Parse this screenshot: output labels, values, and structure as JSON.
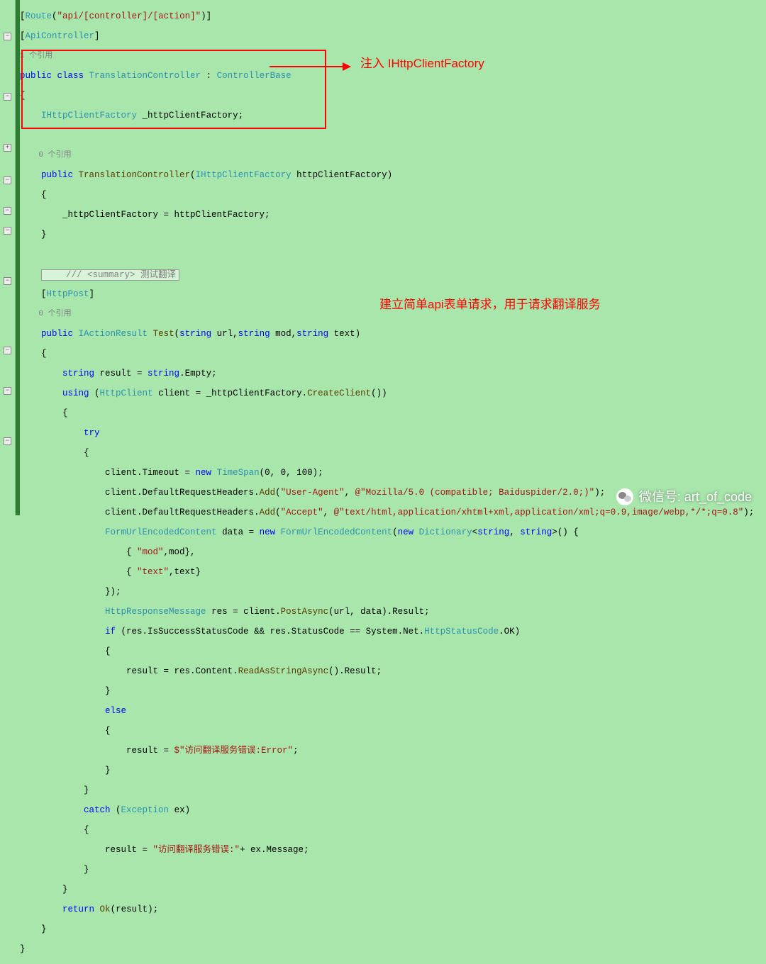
{
  "annotations": {
    "a1": "注入 IHttpClientFactory",
    "a2": "建立简单api表单请求，用于请求翻译服务"
  },
  "watermark": "微信号: art_of_code",
  "lines": {
    "l1a": "[",
    "l1b": "Route",
    "l1c": "(",
    "l1d": "\"api/[controller]/[action]\"",
    "l1e": ")]",
    "l2a": "[",
    "l2b": "ApiController",
    "l2c": "]",
    "l3": "1 个引用",
    "l4a": "public class ",
    "l4b": "TranslationController",
    "l4c": " : ",
    "l4d": "ControllerBase",
    "l5": "{",
    "l6a": "    ",
    "l6b": "IHttpClientFactory",
    "l6c": " _httpClientFactory;",
    "l7": "",
    "l8": "    0 个引用",
    "l9a": "    public ",
    "l9b": "TranslationController",
    "l9c": "(",
    "l9d": "IHttpClientFactory",
    "l9e": " httpClientFactory)",
    "l10": "    {",
    "l11": "        _httpClientFactory = httpClientFactory;",
    "l12": "    }",
    "l13": "",
    "l14": "    /// <summary> 测试翻译",
    "l15a": "    [",
    "l15b": "HttpPost",
    "l15c": "]",
    "l16": "    0 个引用",
    "l17a": "    public ",
    "l17b": "IActionResult",
    "l17c": " ",
    "l17d": "Test",
    "l17e": "(",
    "l17f": "string",
    "l17g": " url,",
    "l17h": "string",
    "l17i": " mod,",
    "l17j": "string",
    "l17k": " text)",
    "l18": "    {",
    "l19a": "        string",
    "l19b": " result = ",
    "l19c": "string",
    "l19d": ".Empty;",
    "l20a": "        using",
    "l20b": " (",
    "l20c": "HttpClient",
    "l20d": " client = _httpClientFactory.",
    "l20e": "CreateClient",
    "l20f": "())",
    "l21": "        {",
    "l22": "            try",
    "l23": "            {",
    "l24a": "                client.Timeout = ",
    "l24b": "new ",
    "l24c": "TimeSpan",
    "l24d": "(0, 0, 100);",
    "l25a": "                client.DefaultRequestHeaders.",
    "l25b": "Add",
    "l25c": "(",
    "l25d": "\"User-Agent\"",
    "l25e": ", ",
    "l25f": "@\"Mozilla/5.0 (compatible; Baiduspider/2.0;)\"",
    "l25g": ");",
    "l26a": "                client.DefaultRequestHeaders.",
    "l26b": "Add",
    "l26c": "(",
    "l26d": "\"Accept\"",
    "l26e": ", ",
    "l26f": "@\"text/html,application/xhtml+xml,application/xml;q=0.9,image/webp,*/*;q=0.8\"",
    "l26g": ");",
    "l27a": "                ",
    "l27b": "FormUrlEncodedContent",
    "l27c": " data = ",
    "l27d": "new ",
    "l27e": "FormUrlEncodedContent",
    "l27f": "(",
    "l27g": "new ",
    "l27h": "Dictionary",
    "l27i": "<",
    "l27j": "string",
    "l27k": ", ",
    "l27l": "string",
    "l27m": ">() {",
    "l28a": "                    { ",
    "l28b": "\"mod\"",
    "l28c": ",mod},",
    "l29a": "                    { ",
    "l29b": "\"text\"",
    "l29c": ",text}",
    "l30": "                });",
    "l31a": "                ",
    "l31b": "HttpResponseMessage",
    "l31c": " res = client.",
    "l31d": "PostAsync",
    "l31e": "(url, data).Result;",
    "l32a": "                if",
    "l32b": " (res.IsSuccessStatusCode && res.StatusCode == System.Net.",
    "l32c": "HttpStatusCode",
    "l32d": ".OK)",
    "l33": "                {",
    "l34a": "                    result = res.Content.",
    "l34b": "ReadAsStringAsync",
    "l34c": "().Result;",
    "l35": "                }",
    "l36": "                else",
    "l37": "                {",
    "l38a": "                    result = ",
    "l38b": "$\"访问翻译服务错误:Error\"",
    "l38c": ";",
    "l39": "                }",
    "l40": "            }",
    "l41a": "            catch",
    "l41b": " (",
    "l41c": "Exception",
    "l41d": " ex)",
    "l42": "            {",
    "l43a": "                result = ",
    "l43b": "\"访问翻译服务错误:\"",
    "l43c": "+ ex.Message;",
    "l44": "            }",
    "l45": "        }",
    "l46a": "        return",
    "l46b": " ",
    "l46c": "Ok",
    "l46d": "(result);",
    "l47": "    }",
    "l48": "}"
  }
}
